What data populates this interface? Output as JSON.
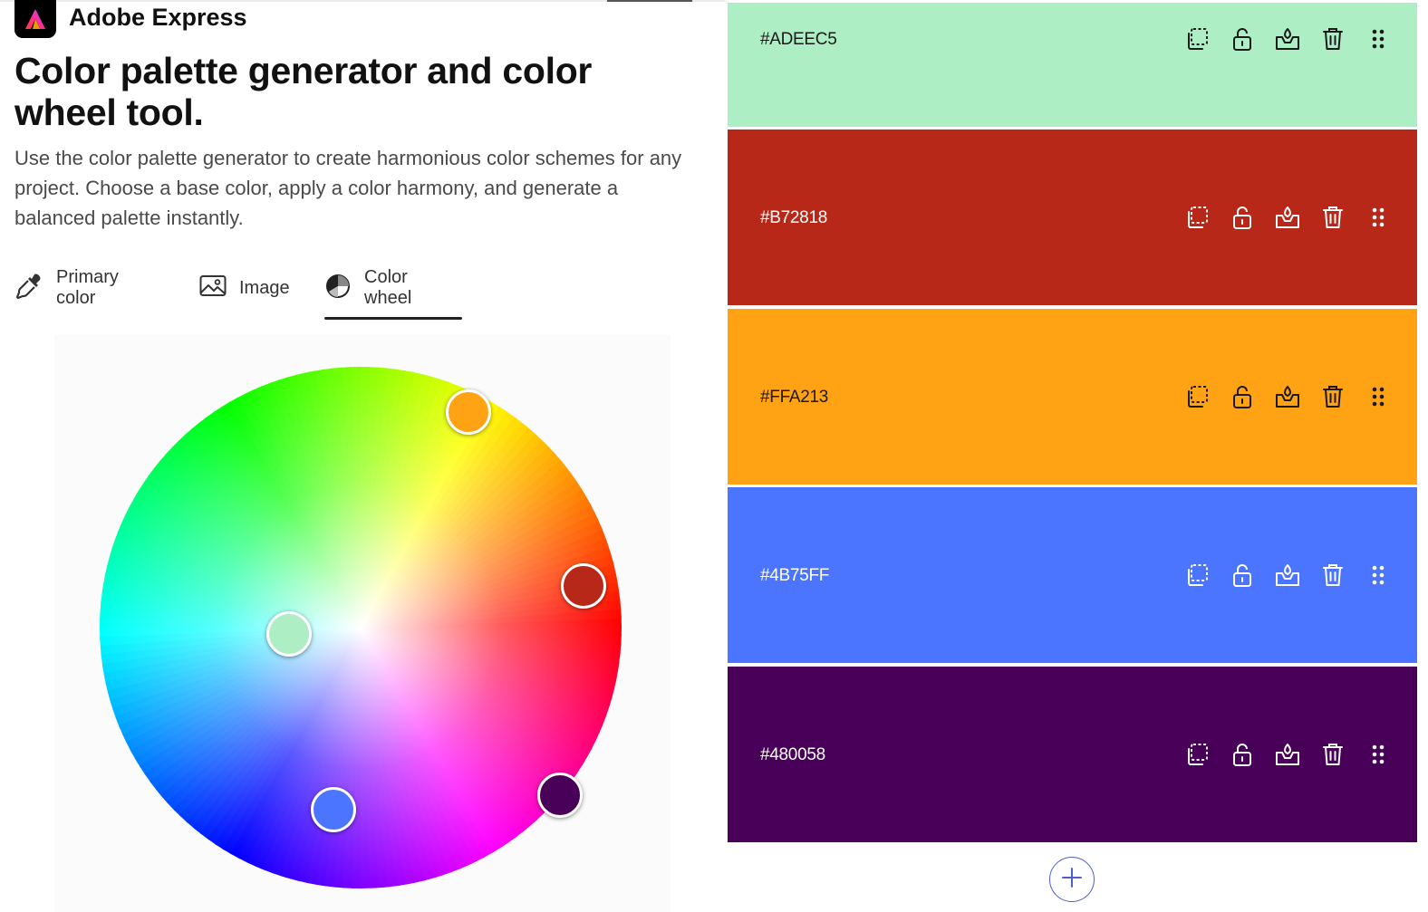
{
  "brand": {
    "name": "Adobe Express",
    "logo_icon": "adobe-express-logo"
  },
  "header": {
    "title": "Color palette generator and color wheel tool.",
    "description": "Use the color palette generator to create harmonious color schemes for any project. Choose a base color, apply a color harmony, and generate a balanced palette instantly."
  },
  "tabs": [
    {
      "label": "Primary color",
      "icon": "eyedropper-icon",
      "active": false
    },
    {
      "label": "Image",
      "icon": "image-icon",
      "active": false
    },
    {
      "label": "Color wheel",
      "icon": "color-wheel-icon",
      "active": true
    }
  ],
  "wheel": {
    "handles": [
      {
        "name": "handle-adeec5",
        "color": "#ADEEC5"
      },
      {
        "name": "handle-b72818",
        "color": "#B72818"
      },
      {
        "name": "handle-ffa213",
        "color": "#FFA213"
      },
      {
        "name": "handle-4b75ff",
        "color": "#4B75FF"
      },
      {
        "name": "handle-480058",
        "color": "#480058"
      }
    ]
  },
  "palette": {
    "swatches": [
      {
        "hex": "#ADEEC5",
        "color": "#ADEEC5",
        "text_color": "#1a1a1a"
      },
      {
        "hex": "#B72818",
        "color": "#B72818",
        "text_color": "#ffffff"
      },
      {
        "hex": "#FFA213",
        "color": "#FFA213",
        "text_color": "#1a1a1a"
      },
      {
        "hex": "#4B75FF",
        "color": "#4B75FF",
        "text_color": "#ffffff"
      },
      {
        "hex": "#480058",
        "color": "#480058",
        "text_color": "#ffffff"
      }
    ],
    "tool_icons": [
      "copy-icon",
      "unlock-icon",
      "color-harmony-icon",
      "trash-icon",
      "drag-handle-icon"
    ],
    "add_icon": "plus-icon",
    "accent": "#4b5fcf"
  }
}
